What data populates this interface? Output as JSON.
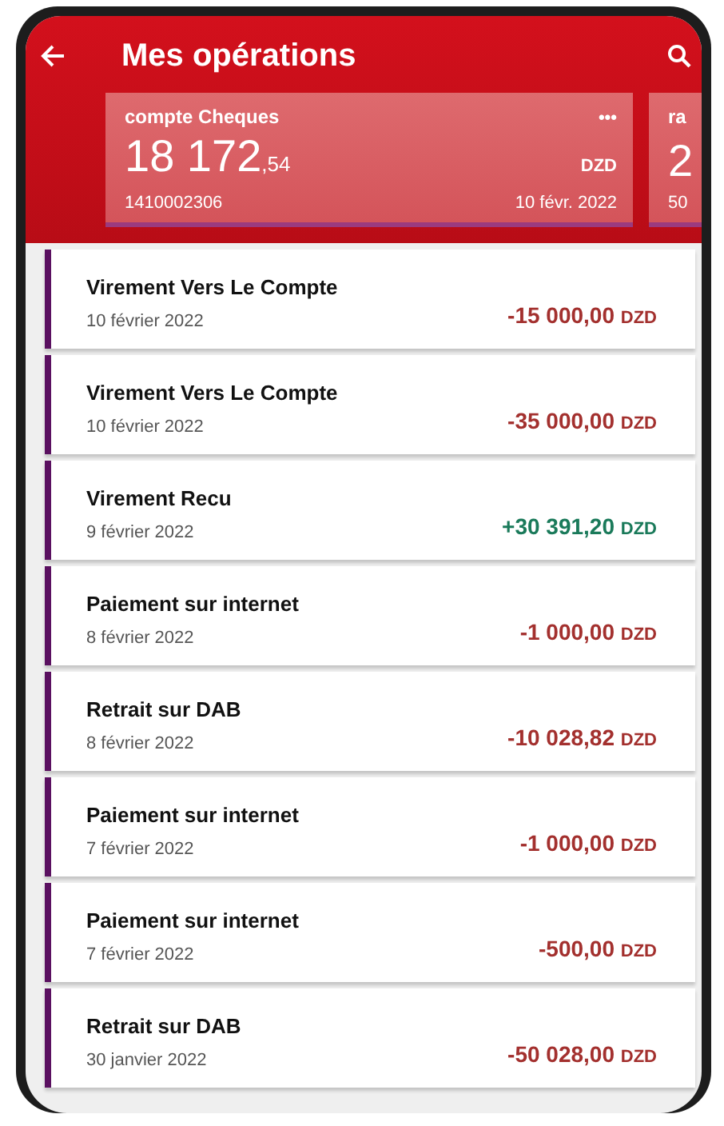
{
  "header": {
    "title": "Mes opérations"
  },
  "accounts": [
    {
      "name": "compte Cheques",
      "balance": "18 172",
      "cents": ",54",
      "currency": "DZD",
      "menu": "•••",
      "number": "1410002306",
      "date": "10 févr. 2022"
    },
    {
      "name": "ra",
      "balance": "2",
      "number": "50"
    }
  ],
  "operations": [
    {
      "label": "Virement Vers Le Compte",
      "date": "10 février 2022",
      "amount": "-15 000,00",
      "currency": "DZD",
      "kind": "debit"
    },
    {
      "label": "Virement Vers Le Compte",
      "date": "10 février 2022",
      "amount": "-35 000,00",
      "currency": "DZD",
      "kind": "debit"
    },
    {
      "label": "Virement Recu",
      "date": "9 février 2022",
      "amount": "+30 391,20",
      "currency": "DZD",
      "kind": "credit"
    },
    {
      "label": "Paiement sur internet",
      "date": "8 février 2022",
      "amount": "-1 000,00",
      "currency": "DZD",
      "kind": "debit"
    },
    {
      "label": "Retrait sur DAB",
      "date": "8 février 2022",
      "amount": "-10 028,82",
      "currency": "DZD",
      "kind": "debit"
    },
    {
      "label": "Paiement sur internet",
      "date": "7 février 2022",
      "amount": "-1 000,00",
      "currency": "DZD",
      "kind": "debit"
    },
    {
      "label": "Paiement sur internet",
      "date": "7 février 2022",
      "amount": "-500,00",
      "currency": "DZD",
      "kind": "debit"
    },
    {
      "label": "Retrait sur DAB",
      "date": "30 janvier 2022",
      "amount": "-50 028,00",
      "currency": "DZD",
      "kind": "debit"
    }
  ]
}
